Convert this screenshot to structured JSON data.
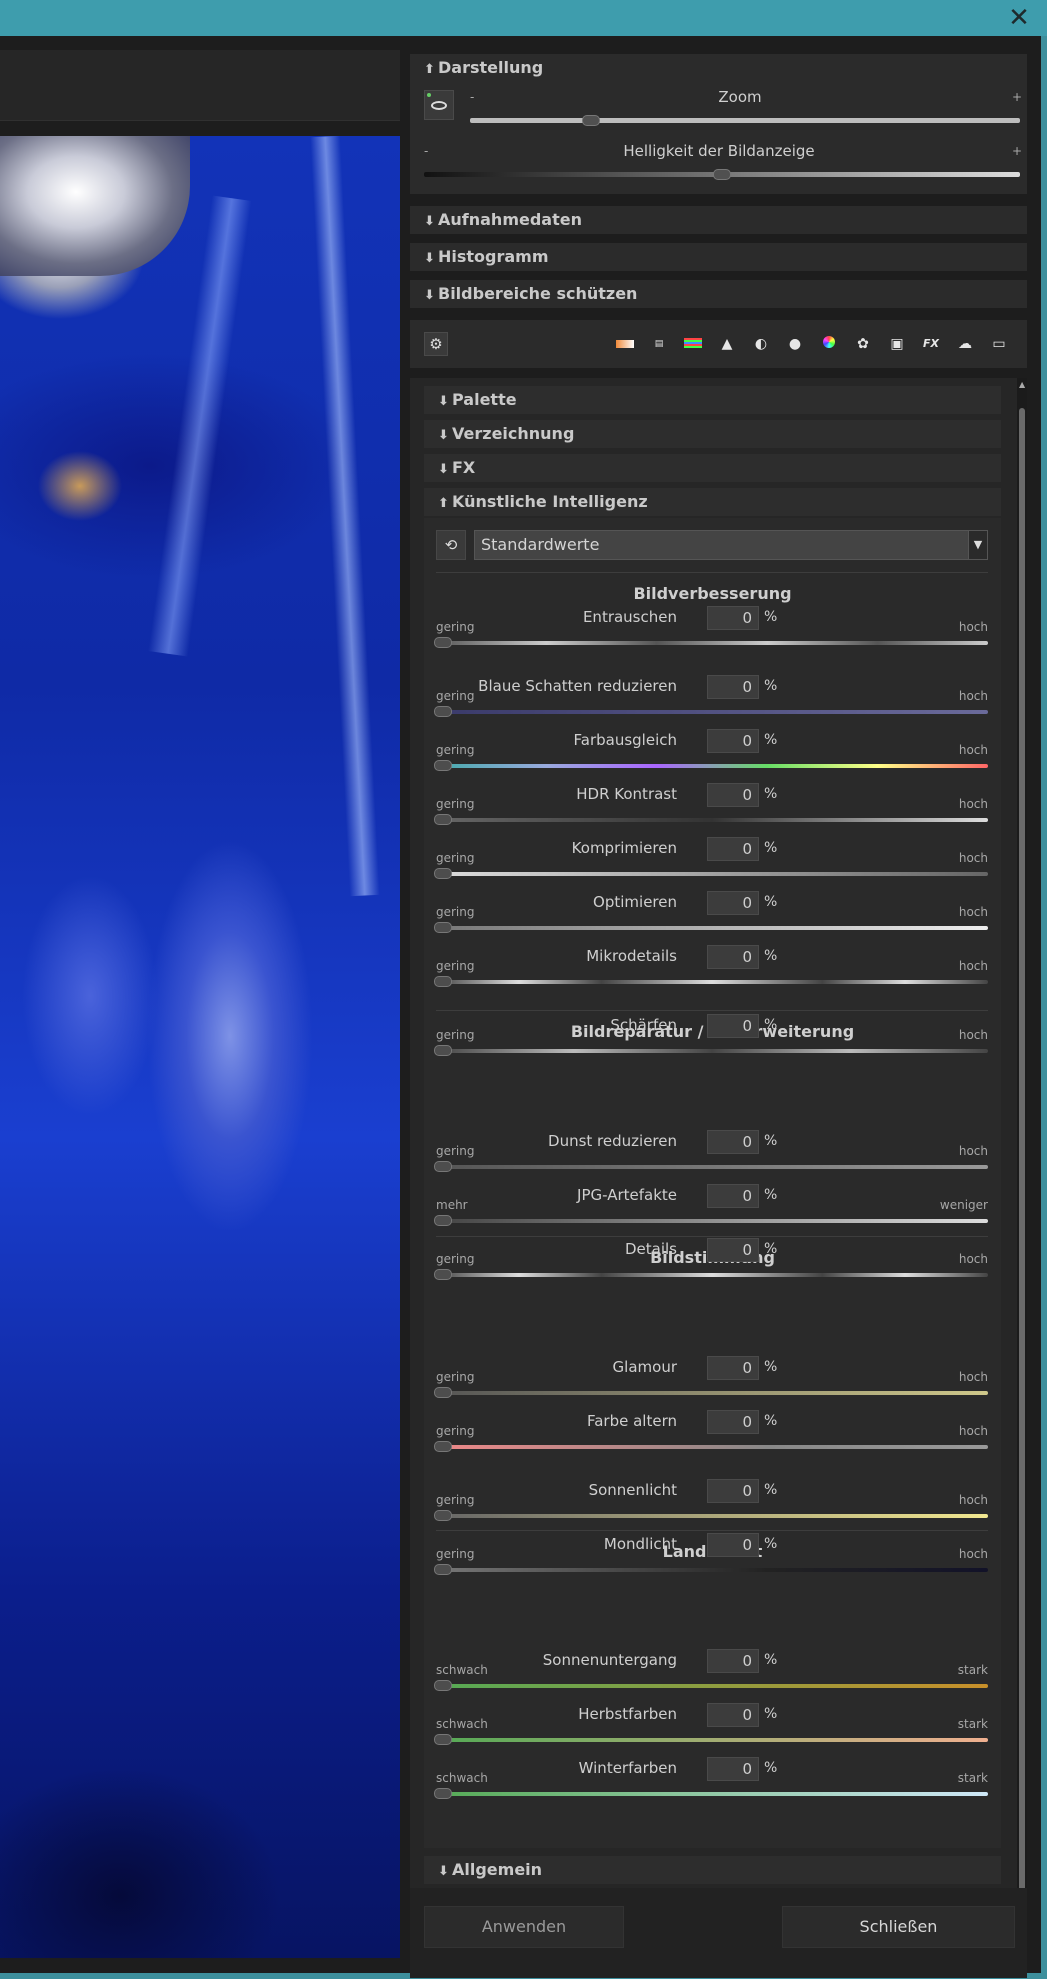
{
  "window": {
    "close_symbol": "✕"
  },
  "darstellung": {
    "title": "Darstellung",
    "zoom_label": "Zoom",
    "zoom_minus": "-",
    "zoom_plus": "+",
    "zoom_level": 0.22,
    "brightness_label": "Helligkeit der Bildanzeige",
    "brightness_minus": "-",
    "brightness_plus": "+",
    "brightness_level": 0.5
  },
  "sections": {
    "aufnahmedaten": "Aufnahmedaten",
    "histogramm": "Histogramm",
    "bildbereiche": "Bildbereiche schützen"
  },
  "toolbar_icons": [
    "gradient-icon",
    "exif-icon",
    "levels-icon",
    "landscape-icon",
    "contrast-icon",
    "lens-icon",
    "color-wheel-icon",
    "palette-icon",
    "camera-icon",
    "fx-icon",
    "brain-icon",
    "film-icon"
  ],
  "subsections": {
    "palette": "Palette",
    "verzeichnung": "Verzeichnung",
    "fx": "FX",
    "ki": "Künstliche Intelligenz",
    "allgemein": "Allgemein"
  },
  "preset": {
    "value": "Standardwerte"
  },
  "groups": [
    {
      "title": "Bildverbesserung"
    },
    {
      "title": "Bildreparatur / Bilderweiterung"
    },
    {
      "title": "Bildstimmung"
    },
    {
      "title": "Landschaft"
    }
  ],
  "sliders": [
    {
      "name": "Entrauschen",
      "lo": "gering",
      "hi": "hoch",
      "value": "0",
      "unit": "%"
    },
    {
      "name": "Blaue Schatten reduzieren",
      "lo": "gering",
      "hi": "hoch",
      "value": "0",
      "unit": "%"
    },
    {
      "name": "Farbausgleich",
      "lo": "gering",
      "hi": "hoch",
      "value": "0",
      "unit": "%"
    },
    {
      "name": "HDR Kontrast",
      "lo": "gering",
      "hi": "hoch",
      "value": "0",
      "unit": "%"
    },
    {
      "name": "Komprimieren",
      "lo": "gering",
      "hi": "hoch",
      "value": "0",
      "unit": "%"
    },
    {
      "name": "Optimieren",
      "lo": "gering",
      "hi": "hoch",
      "value": "0",
      "unit": "%"
    },
    {
      "name": "Mikrodetails",
      "lo": "gering",
      "hi": "hoch",
      "value": "0",
      "unit": "%"
    },
    {
      "name": "Schärfen",
      "lo": "gering",
      "hi": "hoch",
      "value": "0",
      "unit": "%"
    },
    {
      "name": "Dunst reduzieren",
      "lo": "gering",
      "hi": "hoch",
      "value": "0",
      "unit": "%"
    },
    {
      "name": "JPG-Artefakte",
      "lo": "mehr",
      "hi": "weniger",
      "value": "0",
      "unit": "%"
    },
    {
      "name": "Details",
      "lo": "gering",
      "hi": "hoch",
      "value": "0",
      "unit": "%"
    },
    {
      "name": "Glamour",
      "lo": "gering",
      "hi": "hoch",
      "value": "0",
      "unit": "%"
    },
    {
      "name": "Farbe altern",
      "lo": "gering",
      "hi": "hoch",
      "value": "0",
      "unit": "%"
    },
    {
      "name": "Sonnenlicht",
      "lo": "gering",
      "hi": "hoch",
      "value": "0",
      "unit": "%"
    },
    {
      "name": "Mondlicht",
      "lo": "gering",
      "hi": "hoch",
      "value": "0",
      "unit": "%"
    },
    {
      "name": "Sonnenuntergang",
      "lo": "schwach",
      "hi": "stark",
      "value": "0",
      "unit": "%"
    },
    {
      "name": "Herbstfarben",
      "lo": "schwach",
      "hi": "stark",
      "value": "0",
      "unit": "%"
    },
    {
      "name": "Winterfarben",
      "lo": "schwach",
      "hi": "stark",
      "value": "0",
      "unit": "%"
    }
  ],
  "buttons": {
    "apply": "Anwenden",
    "close": "Schließen"
  },
  "colors": {
    "titlebar": "#3e9dad",
    "panel": "#2b2b2b",
    "accent_green": "#6cc66c"
  }
}
